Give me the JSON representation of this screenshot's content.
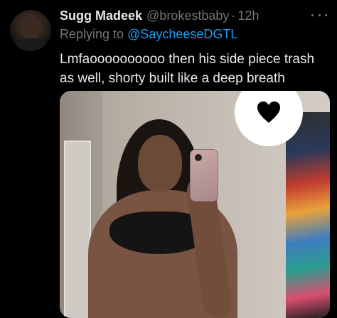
{
  "tweet": {
    "author_name": "Sugg Madeek",
    "author_handle": "@brokestbaby",
    "separator": "·",
    "time": "12h",
    "reply_prefix": "Replying to",
    "reply_to": "@SaycheeseDGTL",
    "text_lines": [
      "Lmfaoooooooooo then his side piece trash",
      "as well, shorty built like a deep breath"
    ]
  },
  "icons": {
    "more": "more-horizontal-icon",
    "sticker": "heart-icon"
  },
  "colors": {
    "background": "#000000",
    "primary_text": "#e7e9ea",
    "secondary_text": "#71767b",
    "link": "#1d9bf0"
  }
}
